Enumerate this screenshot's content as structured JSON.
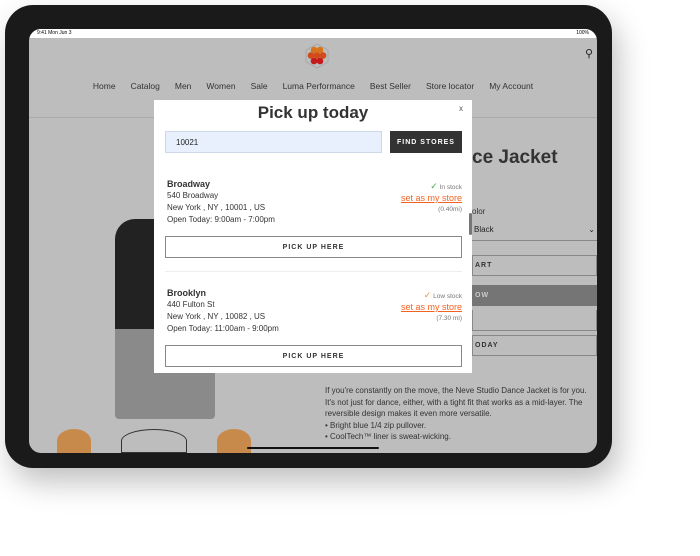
{
  "status": {
    "time": "9:41",
    "date": "Mon Jun 3",
    "battery": "100%"
  },
  "nav": [
    "Home",
    "Catalog",
    "Men",
    "Women",
    "Sale",
    "Luma Performance",
    "Best Seller",
    "Store locator",
    "My Account"
  ],
  "product": {
    "title": "ce Jacket",
    "color_label": "olor",
    "color_value": "Black",
    "buttons": [
      "ART",
      "OW",
      "",
      "ODAY"
    ],
    "description": [
      "If you're constantly on the move, the Neve Studio Dance Jacket is for you. It's not just for dance, either, with a tight fit that works as a mid-layer. The reversible design makes it even more versatile.",
      "• Bright blue 1/4 zip pullover.",
      "• CoolTech™ liner is sweat-wicking."
    ]
  },
  "modal": {
    "title": "Pick up today",
    "close": "x",
    "zip_value": "10021",
    "find_label": "FIND STORES",
    "stores": [
      {
        "name": "Broadway",
        "address": "540 Broadway",
        "city": "New York , NY , 10001 , US",
        "hours": "Open Today: 9:00am - 7:00pm",
        "stock": "In stock",
        "stock_color": "#4caf50",
        "link": "set as my store",
        "distance": "(0.40mi)",
        "button": "PICK UP HERE"
      },
      {
        "name": "Brooklyn",
        "address": "440 Fulton St",
        "city": "New York , NY , 10082 , US",
        "hours": "Open Today: 11:00am - 9:00pm",
        "stock": "Low stock",
        "stock_color": "#f28c38",
        "link": "set as my store",
        "distance": "(7.30 mi)",
        "button": "PICK UP HERE"
      }
    ]
  },
  "colors": {
    "accent": "#f26322",
    "overlay": "#bdbdbd",
    "button_dark": "#333333"
  }
}
